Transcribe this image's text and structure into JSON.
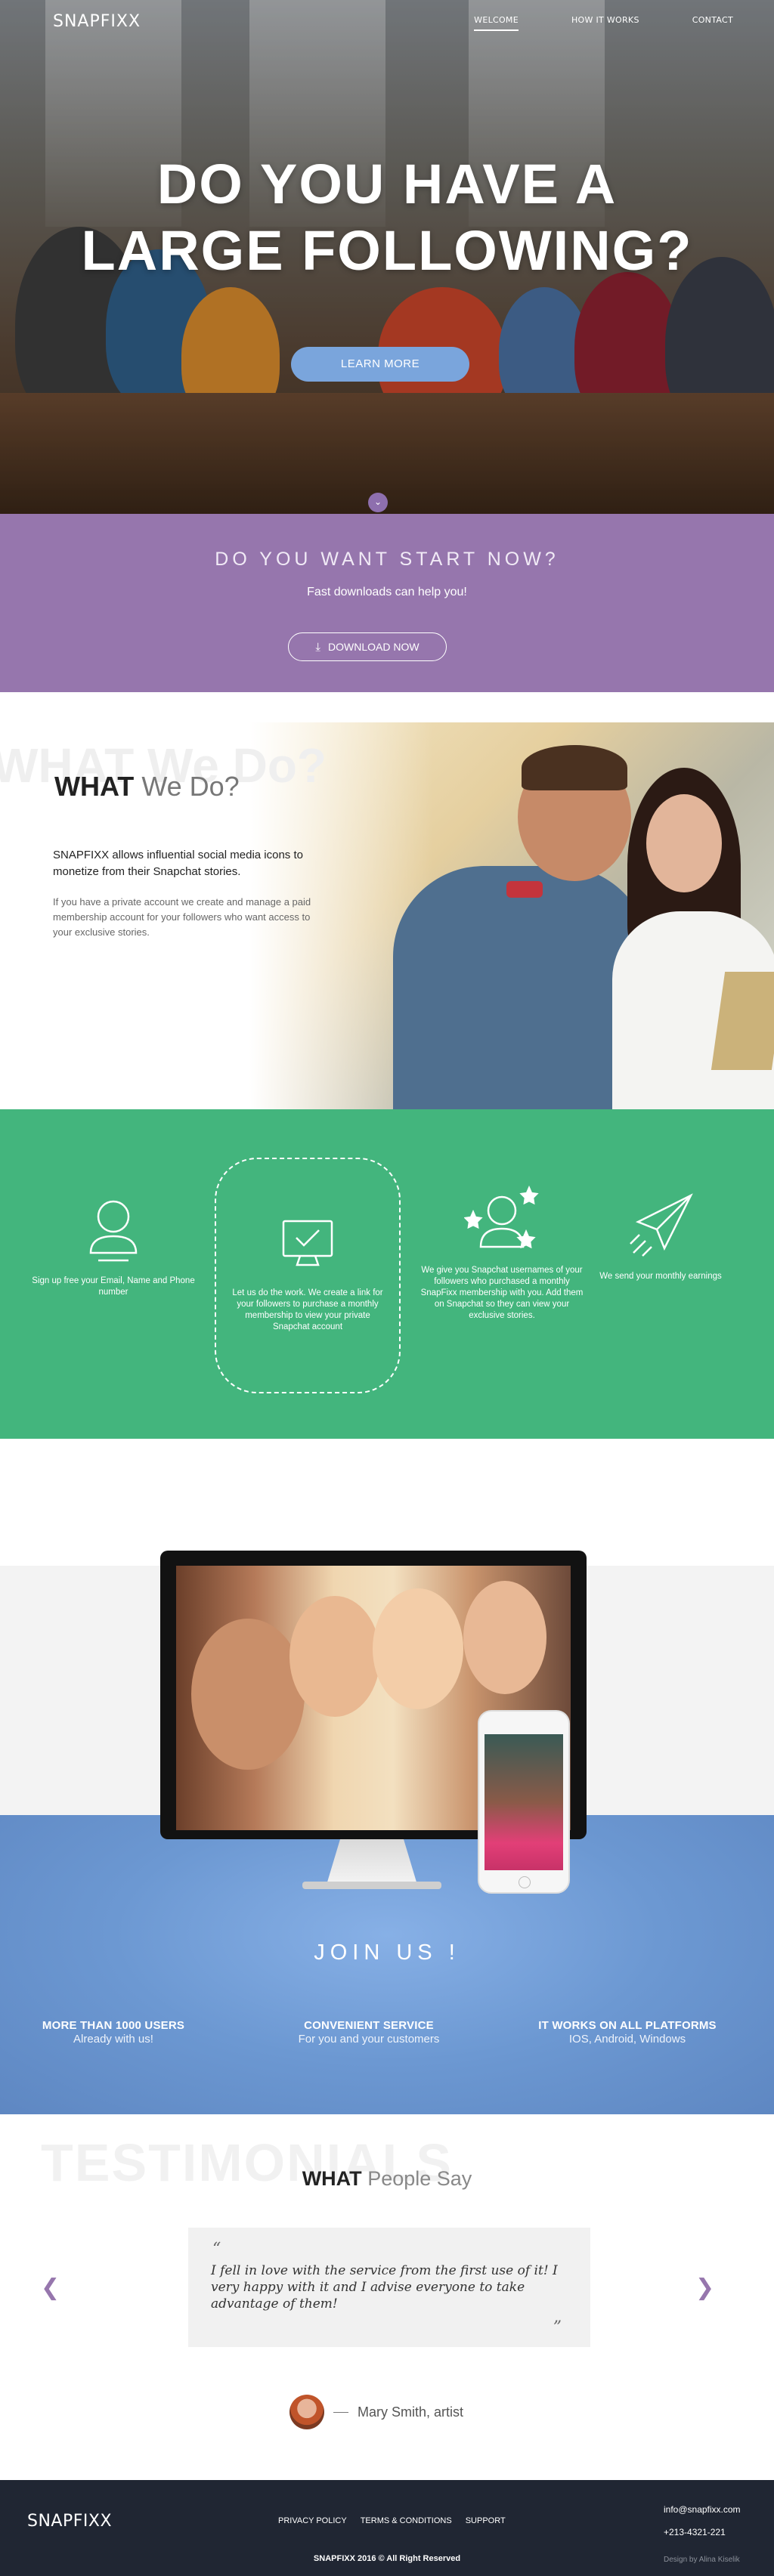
{
  "header": {
    "logo": "SNAPFIXX",
    "nav": [
      {
        "label": "WELCOME",
        "active": true
      },
      {
        "label": "HOW IT WORKS",
        "active": false
      },
      {
        "label": "CONTACT",
        "active": false
      }
    ]
  },
  "hero": {
    "title_line1": "DO YOU HAVE A",
    "title_line2": "LARGE FOLLOWING?",
    "cta": "LEARN MORE",
    "scroll_icon": "chevron-down-icon"
  },
  "start": {
    "heading": "DO YOU WANT START NOW?",
    "subheading": "Fast downloads can help you!",
    "button": "DOWNLOAD NOW",
    "button_icon": "download-icon"
  },
  "what": {
    "bg_word": "WHAT We Do?",
    "title_bold": "WHAT",
    "title_light": "We Do?",
    "lead": "SNAPFIXX allows influential social media icons to monetize from their Snapchat stories.",
    "body": "If you have a private account we create and manage a paid membership account for your followers who want access to your exclusive stories."
  },
  "steps": [
    {
      "icon": "user-icon",
      "text": "Sign up free your Email, Name and Phone number"
    },
    {
      "icon": "monitor-check-icon",
      "text": "Let us do the work. We create a link for your followers to purchase a monthly membership to view your private Snapchat account"
    },
    {
      "icon": "user-stars-icon",
      "text": "We give you Snapchat usernames of your followers who purchased a monthly SnapFixx membership with you. Add them on Snapchat so they can view your exclusive stories."
    },
    {
      "icon": "paper-plane-icon",
      "text": "We send your monthly earnings"
    }
  ],
  "join": {
    "heading": "JOIN US !",
    "features": [
      {
        "title": "MORE THAN 1000 USERS",
        "sub": "Already with us!"
      },
      {
        "title": "CONVENIENT SERVICE",
        "sub": "For you and your customers"
      },
      {
        "title": "IT WORKS ON ALL PLATFORMS",
        "sub": "IOS, Android, Windows"
      }
    ]
  },
  "testimonials": {
    "bg_word": "TESTIMONIALS",
    "title_bold": "WHAT",
    "title_light": "People Say",
    "quote_open": "“",
    "quote_close": "”",
    "quote": "I fell in love with the service from the first use of it! I very happy with it and I advise everyone to take advantage of them!",
    "author": "Mary Smith, artist",
    "prev_icon": "chevron-left-icon",
    "next_icon": "chevron-right-icon"
  },
  "footer": {
    "logo": "SNAPFIXX",
    "links": [
      "PRIVACY POLICY",
      "TERMS & CONDITIONS",
      "SUPPORT"
    ],
    "copyright": "SNAPFIXX 2016 © All Right Reserved",
    "email": "info@snapfixx.com",
    "phone": "+213-4321-221",
    "credit": "Design by Alina Kiselik"
  },
  "colors": {
    "purple": "#9676ad",
    "green": "#43b57d",
    "blue": "#6c98d2",
    "cta_blue": "#7aa5dc",
    "footer": "#202633"
  }
}
